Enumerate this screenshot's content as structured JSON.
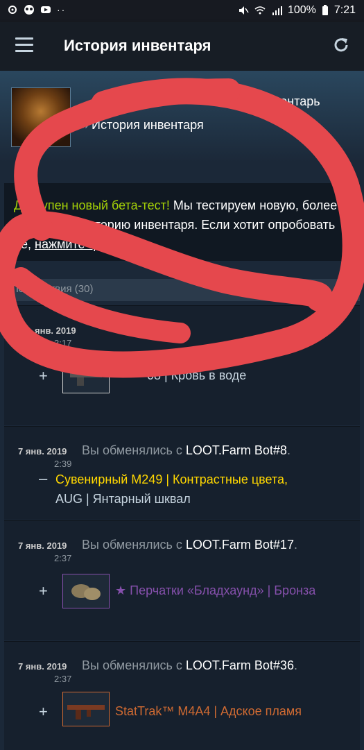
{
  "status_bar": {
    "battery": "100%",
    "time": "7:21"
  },
  "app_bar": {
    "title": "История инвентаря"
  },
  "profile": {
    "name": "",
    "crumb_inventory": "Инвентарь",
    "crumb_sep": "»",
    "crumb_history": "История инвентаря"
  },
  "beta": {
    "highlight": "Доступен новый бета-тест!",
    "text1": " Мы тестируем новую, более подробную историю инвентаря. Если хотит опробовать её, ",
    "link": "нажмите здесь",
    "tail": "."
  },
  "filter": {
    "label": "По действия (30)"
  },
  "entries": [
    {
      "date": "янв. 2019",
      "time": "3:17",
      "prefix": "",
      "partner": "",
      "suffix": "",
      "sign": "+",
      "items": [
        {
          "name": "08 | Кровь в воде",
          "color": "#c6d4df",
          "border": "#d2d2d2"
        }
      ]
    },
    {
      "date": "7 янв. 2019",
      "time": "2:39",
      "prefix": "Вы обменялись с ",
      "partner": "LOOT.Farm Bot#8",
      "suffix": ".",
      "sign": "–",
      "items": [
        {
          "name": "Сувенирный M249 | Контрастные цвета,",
          "color": "#ffd700"
        },
        {
          "name": "AUG | Янтарный шквал",
          "color": "#c6d4df"
        }
      ]
    },
    {
      "date": "7 янв. 2019",
      "time": "2:37",
      "prefix": "Вы обменялись с ",
      "partner": "LOOT.Farm Bot#17",
      "suffix": ".",
      "sign": "+",
      "items": [
        {
          "name": "★ Перчатки «Бладхаунд» | Бронза",
          "color": "#8650ac",
          "border": "#8650ac"
        }
      ]
    },
    {
      "date": "7 янв. 2019",
      "time": "2:37",
      "prefix": "Вы обменялись с ",
      "partner": "LOOT.Farm Bot#36",
      "suffix": ".",
      "sign": "+",
      "items": [
        {
          "name": "StatTrak™ M4A4 | Адское пламя",
          "color": "#cf6a32",
          "border": "#cf6a32"
        }
      ]
    }
  ],
  "colors": {
    "scribble": "#e5484d",
    "bg": "#1b2838"
  }
}
